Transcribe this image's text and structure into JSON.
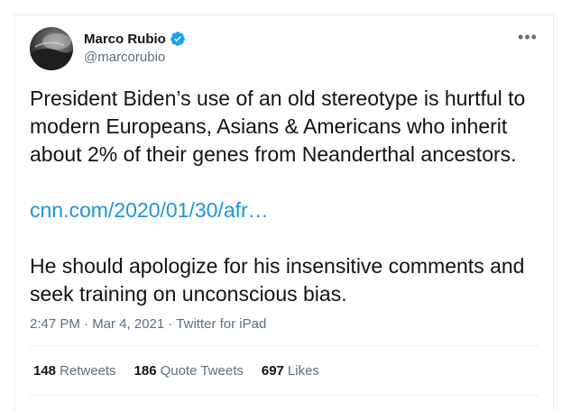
{
  "tweet": {
    "author": {
      "display_name": "Marco Rubio",
      "handle": "@marcorubio",
      "verified": true
    },
    "more_label": "•••",
    "text": {
      "paragraph1": "President Biden’s use of an old stereotype is hurtful to modern Europeans, Asians & Americans who inherit about 2% of their genes from Neanderthal ancestors.",
      "link": "cnn.com/2020/01/30/afr…",
      "paragraph2": "He should apologize for his insensitive comments and seek training on unconscious bias."
    },
    "meta": "2:47 PM · Mar 4, 2021 · Twitter for iPad",
    "stats": {
      "retweets_count": "148",
      "retweets_label": "Retweets",
      "quote_count": "186",
      "quote_label": "Quote Tweets",
      "likes_count": "697",
      "likes_label": "Likes"
    }
  },
  "colors": {
    "link": "#1b95e0",
    "secondary_text": "#5b7083",
    "verified": "#1da1f2",
    "divider": "#e6ecf0"
  },
  "icons": {
    "verified": "verified-badge-icon",
    "more": "more-options-icon"
  }
}
